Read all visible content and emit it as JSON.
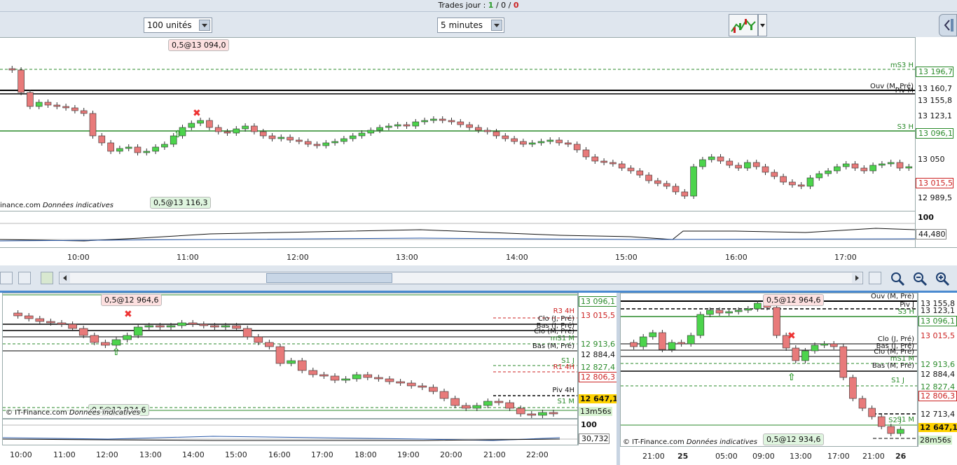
{
  "header": {
    "trades_label": "Trades jour :",
    "trades_won": "1",
    "sep1": "/",
    "trades_neutral": "0",
    "sep2": "/",
    "trades_lost": "0"
  },
  "toolbar": {
    "quantity": "100 unités",
    "timeframe": "5 minutes"
  },
  "main_chart": {
    "order_sell_tag": "0,5@13 094,0",
    "order_buy_tag": "0,5@13 116,3",
    "watermark": "inance.com",
    "disclaimer": "Données indicatives",
    "levels": [
      {
        "name": "mS3 H",
        "value": "13 196,7",
        "color": "#2a8a2a"
      },
      {
        "name": "Ouv (M, Pré)",
        "value": "13 160,7",
        "color": "#111"
      },
      {
        "name": "Piv M",
        "value": "13 155,8",
        "color": "#111"
      },
      {
        "name": "",
        "value": "13 123,1",
        "color": "#111"
      },
      {
        "name": "S3 H",
        "value": "13 096,1",
        "color": "#2a8a2a"
      },
      {
        "name": "",
        "value": "13 050",
        "color": "#111"
      },
      {
        "name": "",
        "value": "13 015,5",
        "color": "#c22"
      },
      {
        "name": "",
        "value": "12 989,5",
        "color": "#111"
      }
    ],
    "osc_top": "100",
    "osc_value": "44,480",
    "time_labels": [
      "10:00",
      "11:00",
      "12:00",
      "13:00",
      "14:00",
      "15:00",
      "16:00",
      "17:00"
    ]
  },
  "bottom_left": {
    "order_sell_tag": "0,5@12 964,6",
    "order_buy_tag": "0,5@12 934,6",
    "watermark": "© IT-Finance.com",
    "disclaimer": "Données indicatives",
    "labels": [
      {
        "name": "R3 4H",
        "color": "#c22"
      },
      {
        "name": "Clo (J, Pré)",
        "color": "#111"
      },
      {
        "name": "Bas (J, Pré)",
        "color": "#111"
      },
      {
        "name": "Clo (M, Pré)",
        "color": "#111"
      },
      {
        "name": "mS1 M",
        "color": "#2a8a2a"
      },
      {
        "name": "Bas (M, Pré)",
        "color": "#111"
      },
      {
        "name": "S1 J",
        "color": "#2a8a2a"
      },
      {
        "name": "R1 4H",
        "color": "#c22"
      },
      {
        "name": "Piv 4H",
        "color": "#111"
      },
      {
        "name": "S1 M",
        "color": "#2a8a2a"
      }
    ],
    "axis": [
      "13 096,1",
      "13 015,5",
      "12 913,6",
      "12 884,4",
      "12 827,4",
      "12 806,3",
      "12 647,1",
      "13m56s"
    ],
    "osc_top": "100",
    "osc_value": "30,732",
    "time_labels": [
      "10:00",
      "11:00",
      "12:00",
      "13:00",
      "14:00",
      "15:00",
      "16:00",
      "17:00",
      "18:00",
      "19:00",
      "20:00",
      "21:00",
      "22:00"
    ]
  },
  "bottom_right": {
    "order_sell_tag": "0,5@12 964,6",
    "order_buy_tag": "0,5@12 934,6",
    "watermark": "© IT-Finance.com",
    "disclaimer": "Données indicatives",
    "labels": [
      {
        "name": "Ouv (M, Pré)",
        "color": "#111"
      },
      {
        "name": "Piv J",
        "color": "#111"
      },
      {
        "name": "S3 H",
        "color": "#2a8a2a"
      },
      {
        "name": "Clo (J, Pré)",
        "color": "#111"
      },
      {
        "name": "Bas (J, Pré)",
        "color": "#111"
      },
      {
        "name": "Clo (M, Pré)",
        "color": "#111"
      },
      {
        "name": "mS1 M",
        "color": "#2a8a2a"
      },
      {
        "name": "Bas (M, Pré)",
        "color": "#111"
      },
      {
        "name": "S1 J",
        "color": "#2a8a2a"
      },
      {
        "name": "S2 J",
        "color": "#2a8a2a"
      },
      {
        "name": "S1 M",
        "color": "#2a8a2a"
      }
    ],
    "axis": [
      "13 155,8",
      "13 123,1",
      "13 096,1",
      "13 015,5",
      "12 913,6",
      "12 884,4",
      "12 827,4",
      "12 806,3",
      "12 713,4",
      "12 647,1",
      "28m56s"
    ],
    "time_labels": [
      "21:00",
      "25",
      "05:00",
      "09:00",
      "13:00",
      "17:00",
      "21:00",
      "26"
    ]
  }
}
